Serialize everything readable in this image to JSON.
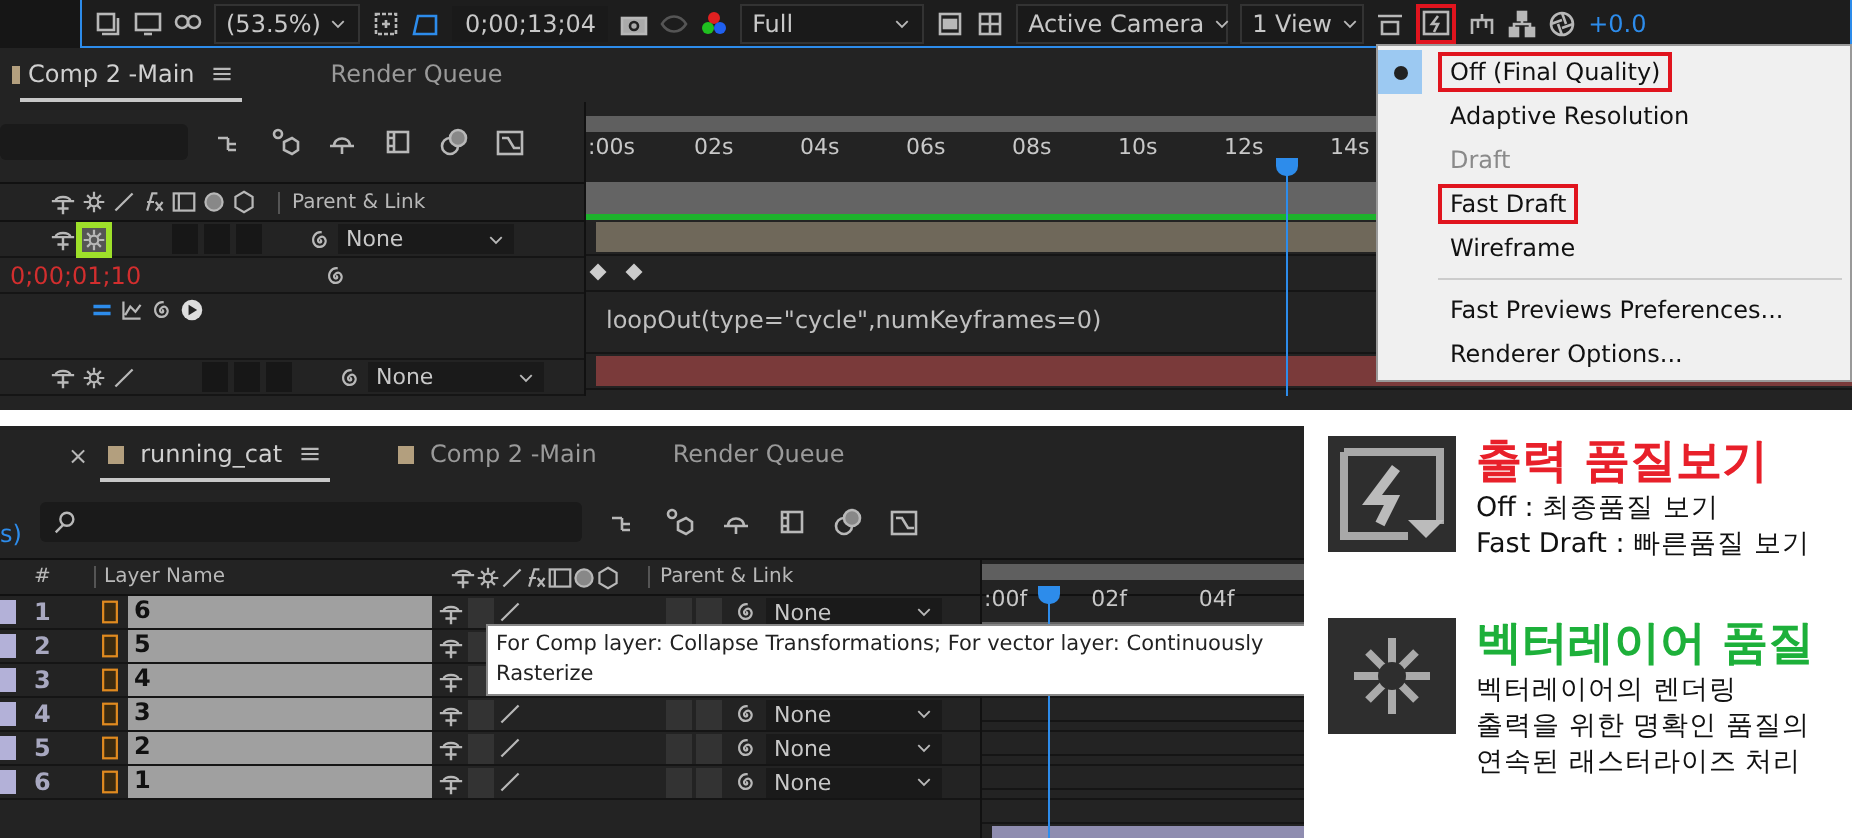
{
  "top_panel": {
    "toolbar": {
      "zoom": "(53.5%)",
      "timecode": "0;00;13;04",
      "resolution": "Full",
      "view": "Active Camera",
      "layout": "1 View",
      "exposure": "+0.0",
      "fast_previews_highlighted": true
    },
    "tabs": [
      {
        "label": "Comp 2 -Main",
        "selected": true
      },
      {
        "label": "Render Queue",
        "selected": false
      }
    ],
    "ruler": [
      ":00s",
      "02s",
      "04s",
      "06s",
      "08s",
      "10s",
      "12s",
      "14s"
    ],
    "header": "Parent & Link",
    "rows": [
      {
        "kind": "layer",
        "parent": "None",
        "highlighted": true,
        "color": "#6f685a"
      },
      {
        "kind": "time",
        "time": "0;00;01;10"
      },
      {
        "kind": "expression",
        "expression": "loopOut(type=\"cycle\",numKeyframes=0)"
      },
      {
        "kind": "layer",
        "parent": "None",
        "highlighted": false,
        "color": "#7a3a3a"
      }
    ],
    "menu": [
      {
        "kind": "item",
        "label": "Off (Final Quality)",
        "selected": true,
        "disabled": false,
        "highlighted": true
      },
      {
        "kind": "item",
        "label": "Adaptive Resolution",
        "selected": false,
        "disabled": false,
        "highlighted": false
      },
      {
        "kind": "item",
        "label": "Draft",
        "selected": false,
        "disabled": true,
        "highlighted": false
      },
      {
        "kind": "item",
        "label": "Fast Draft",
        "selected": false,
        "disabled": false,
        "highlighted": true
      },
      {
        "kind": "item",
        "label": "Wireframe",
        "selected": false,
        "disabled": false,
        "highlighted": false
      },
      {
        "kind": "separator"
      },
      {
        "kind": "item",
        "label": "Fast Previews Preferences...",
        "selected": false,
        "disabled": false,
        "highlighted": false
      },
      {
        "kind": "item",
        "label": "Renderer Options...",
        "selected": false,
        "disabled": false,
        "highlighted": false
      }
    ]
  },
  "bottom_panel": {
    "left_fragment": "s)",
    "tabs": [
      {
        "label": "running_cat",
        "close": "×",
        "selected": true
      },
      {
        "label": "Comp 2 -Main",
        "selected": false
      },
      {
        "label": "Render Queue",
        "selected": false
      }
    ],
    "header": {
      "number": "#",
      "name": "Layer Name",
      "parent": "Parent & Link"
    },
    "ruler": [
      ":00f",
      "02f",
      "04f"
    ],
    "layers": [
      {
        "number": "1",
        "name": "6",
        "parent": "None"
      },
      {
        "number": "2",
        "name": "5"
      },
      {
        "number": "3",
        "name": "4"
      },
      {
        "number": "4",
        "name": "3",
        "parent": "None"
      },
      {
        "number": "5",
        "name": "2",
        "parent": "None"
      },
      {
        "number": "6",
        "name": "1",
        "parent": "None",
        "color": "#8f8db0"
      }
    ],
    "tooltip": "For Comp layer: Collapse Transformations; For vector layer: Continuously Rasterize"
  },
  "notes": [
    {
      "kind": "fast_previews",
      "title": "출력 품질보기",
      "color": "#e8202a",
      "lines": [
        "Off : 최종품질 보기",
        "Fast Draft : 빠른품질 보기"
      ]
    },
    {
      "kind": "vector_quality",
      "title": "벡터레이어 품질",
      "color": "#1db03a",
      "lines": [
        "벡터레이어의 렌더링",
        "출력을 위한 명확인 품질의",
        "연속된 래스터라이즈 처리"
      ]
    }
  ]
}
